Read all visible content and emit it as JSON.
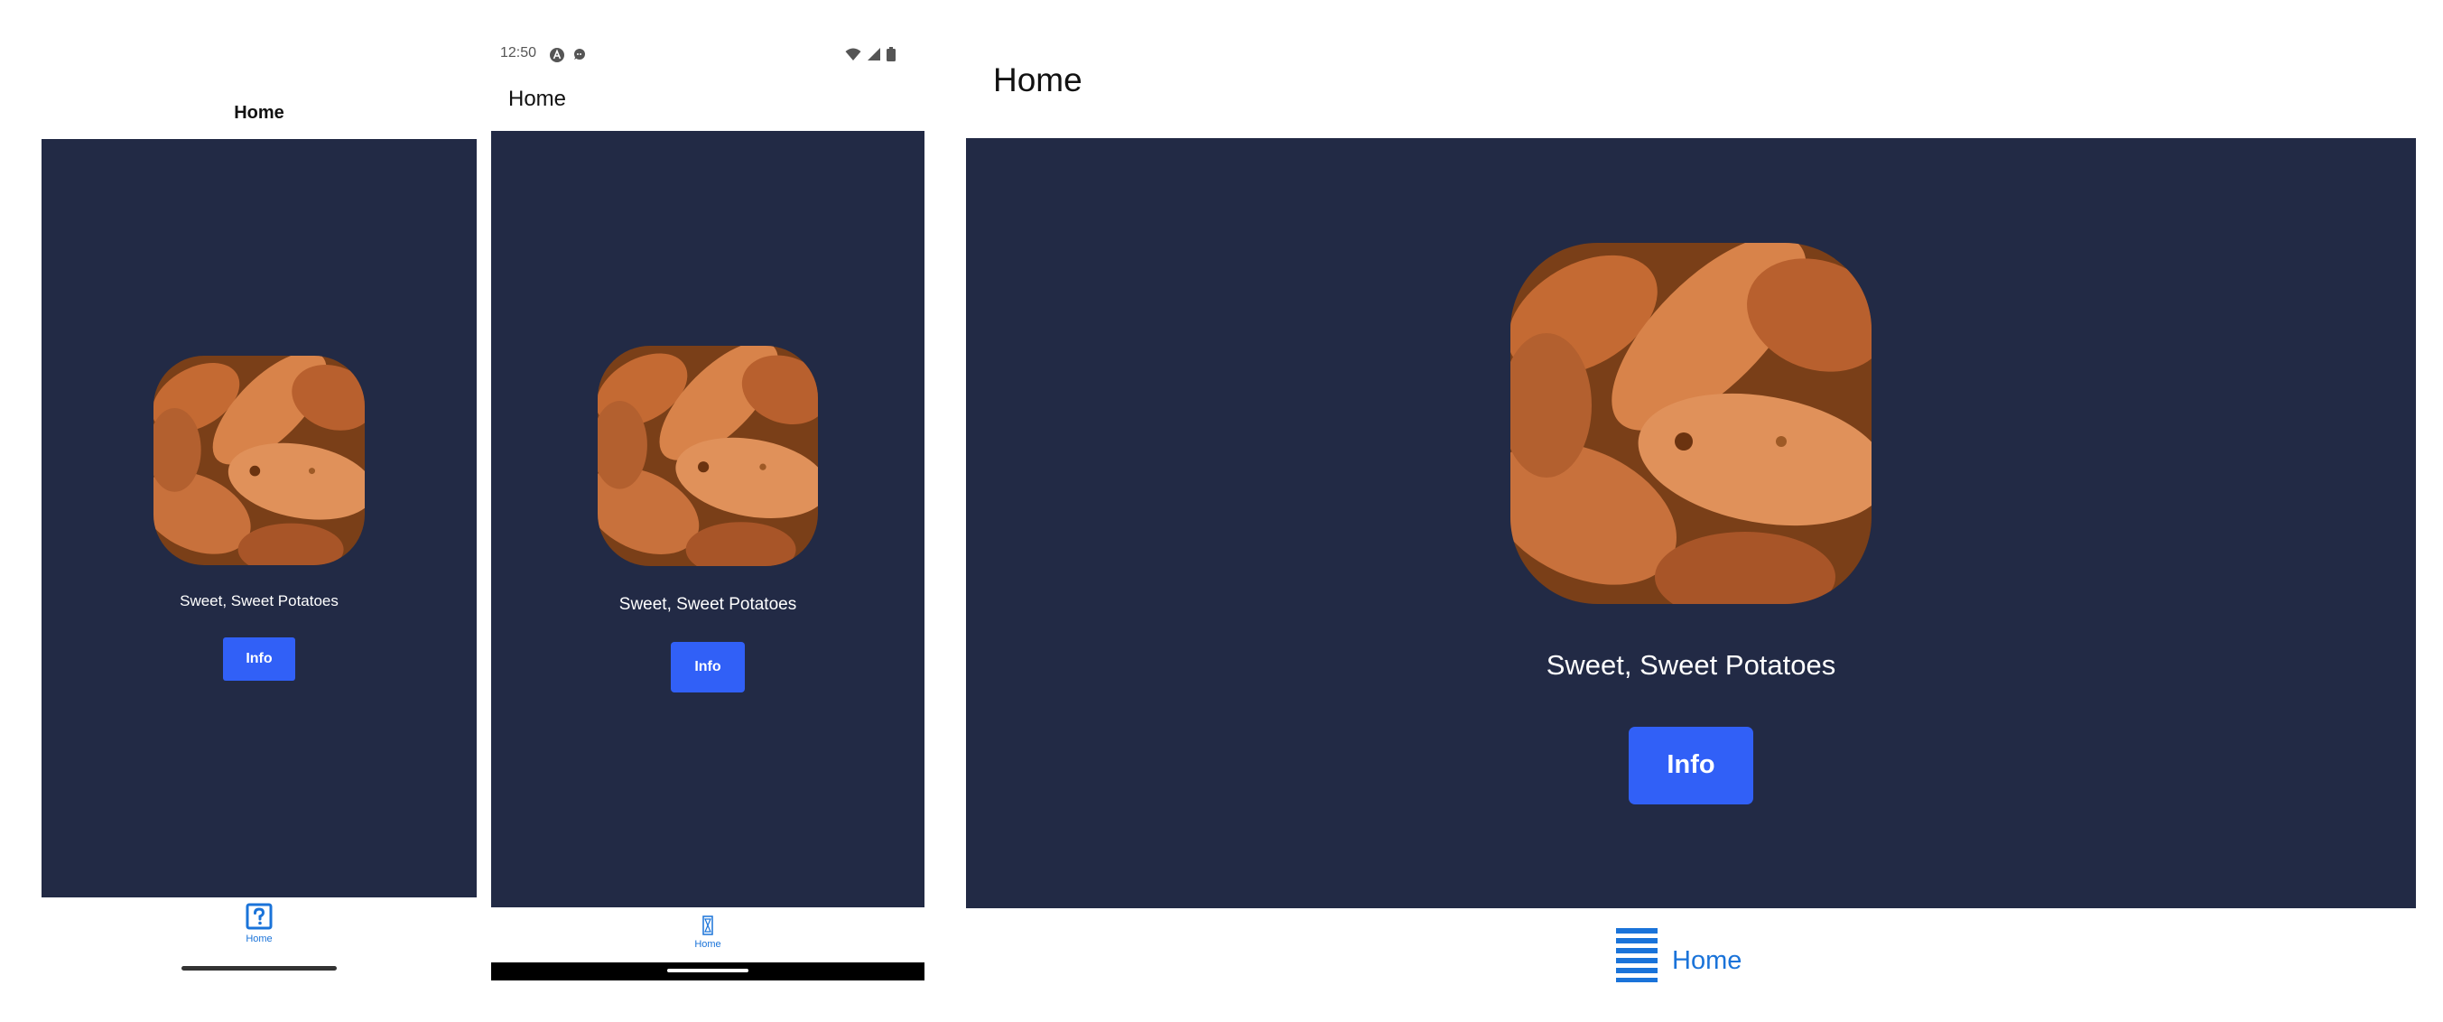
{
  "screen_title": "Home",
  "caption": "Sweet, Sweet Potatoes",
  "info_button_label": "Info",
  "tab_label": "Home",
  "status_bar": {
    "time": "12:50"
  },
  "colors": {
    "content_background": "#222a45",
    "button": "#3160f7",
    "tab_accent": "#1a73d9",
    "page_background": "#ffffff"
  },
  "icons": {
    "ios_tab": "help-square-icon",
    "android_tab": "hourglass-icon",
    "web_tab": "list-icon"
  },
  "image_subject": "sweet potatoes"
}
